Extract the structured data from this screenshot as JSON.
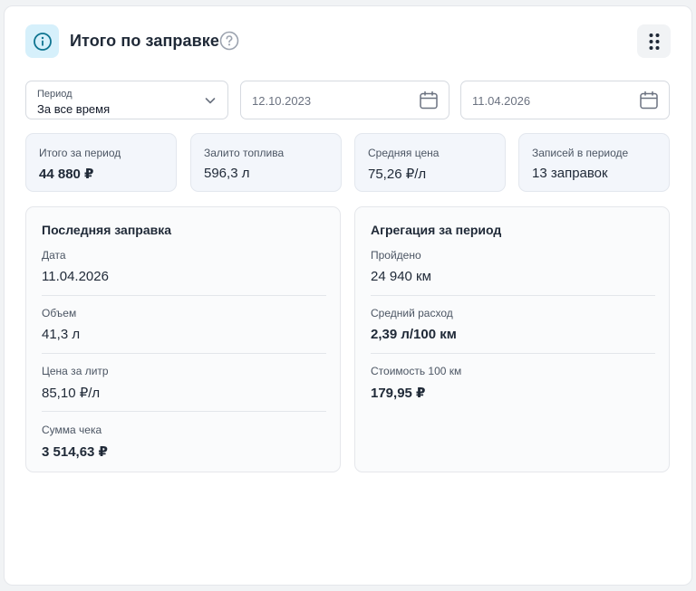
{
  "header": {
    "title": "Итого по заправке",
    "info_icon": "info-icon",
    "help_icon": "help-circle-icon",
    "menu_icon": "grip-dots-icon"
  },
  "filters": {
    "period_label": "Период",
    "period_value": "За все время",
    "date_from": "12.10.2023",
    "date_to": "11.04.2026"
  },
  "stats": [
    {
      "label": "Итого за период",
      "value": "44 880 ₽"
    },
    {
      "label": "Залито топлива",
      "value": "596,3 л"
    },
    {
      "label": "Средняя цена",
      "value": "75,26 ₽/л"
    },
    {
      "label": "Записей в периоде",
      "value": "13 заправок"
    }
  ],
  "last_refuel": {
    "title": "Последняя заправка",
    "rows": [
      {
        "label": "Дата",
        "value": "11.04.2026"
      },
      {
        "label": "Объем",
        "value": "41,3 л"
      },
      {
        "label": "Цена за литр",
        "value": "85,10 ₽/л"
      },
      {
        "label": "Сумма чека",
        "value": "3 514,63 ₽"
      }
    ]
  },
  "aggregation": {
    "title": "Агрегация за период",
    "rows": [
      {
        "label": "Пройдено",
        "value": "24 940 км"
      },
      {
        "label": "Средний расход",
        "value": "2,39 л/100 км"
      },
      {
        "label": "Стоимость 100 км",
        "value": "179,95 ₽"
      }
    ]
  },
  "colors": {
    "accent": "#0e7490",
    "badge_bg": "#d6f0fb",
    "stat_bg": "#f3f6fb"
  }
}
